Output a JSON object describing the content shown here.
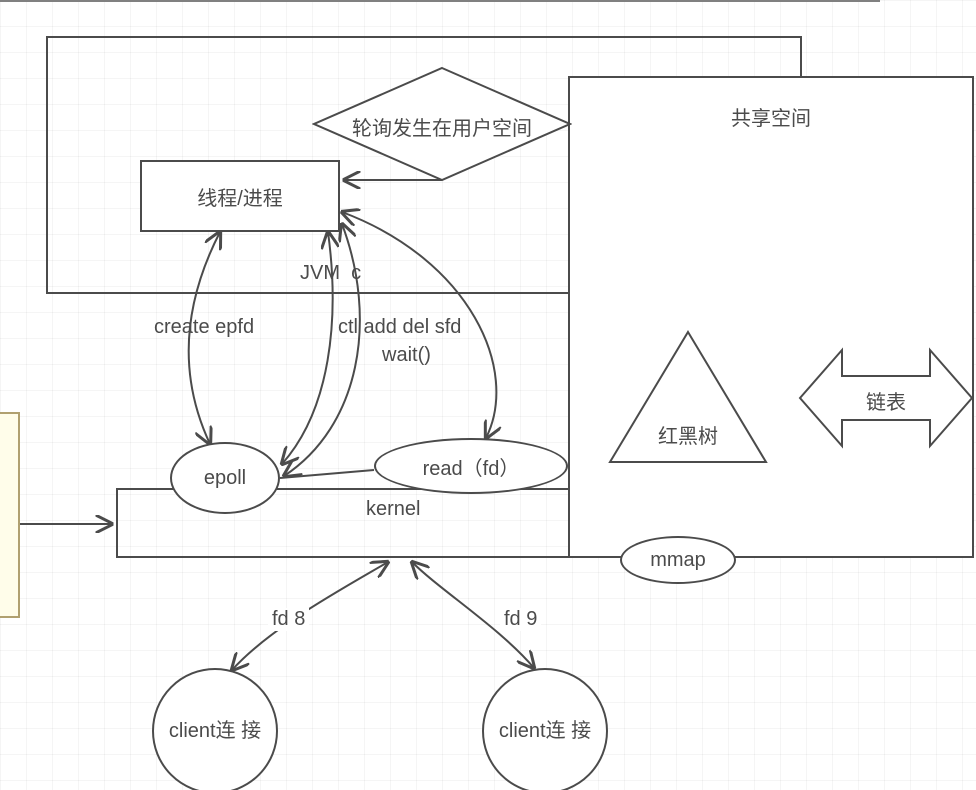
{
  "diagram": {
    "jvm_box_label": "JVM  c",
    "thread_box": "线程/进程",
    "polling_diamond": "轮询发生在用户空间",
    "shared_space_box": "共享空间",
    "rb_tree": "红黑树",
    "linked_list": "链表",
    "kernel_box_label": "kernel",
    "epoll_node": "epoll",
    "read_node": "read（fd）",
    "mmap_node": "mmap",
    "client1": "client连\n接",
    "client2": "client连\n接",
    "edge_create_epfd": "create epfd",
    "edge_ctl_add": "ctl add del sfd",
    "edge_wait": "wait()",
    "edge_fd8": "fd 8",
    "edge_fd9": "fd 9"
  }
}
